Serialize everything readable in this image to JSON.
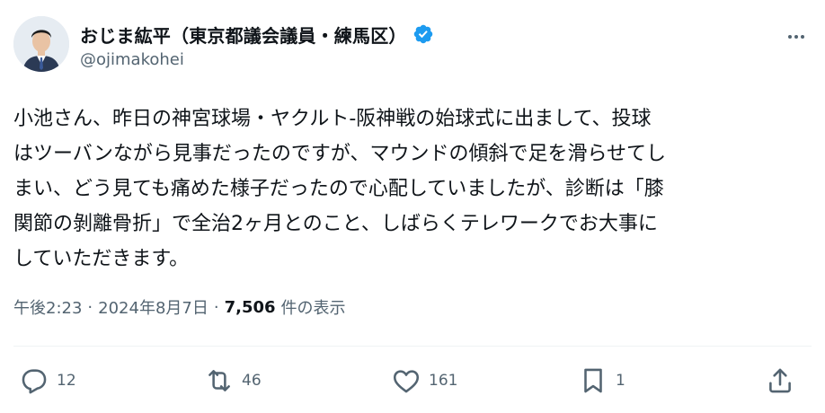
{
  "author": {
    "display_name": "おじま紘平（東京都議会議員・練馬区）",
    "handle": "@ojimakohei",
    "verified": true,
    "avatar_icon": "avatar-photo",
    "verified_color": "#1d9bf0"
  },
  "more_icon": "more-horizontal-icon",
  "tweet": {
    "lines": [
      "小池さん、昨日の神宮球場・ヤクルト-阪神戦の始球式に出まして、投球",
      "はツーバンながら見事だったのですが、マウンドの傾斜で足を滑らせてし",
      "まい、どう見ても痛めた様子だったので心配していましたが、診断は「膝",
      "関節の剝離骨折」で全治2ヶ月とのこと、しばらくテレワークでお大事に",
      "していただきます。"
    ]
  },
  "meta": {
    "time": "午後2:23",
    "separator": "·",
    "date": "2024年8月7日",
    "views_count": "7,506",
    "views_label": "件の表示"
  },
  "actions": {
    "reply": {
      "icon": "reply-icon",
      "count": "12"
    },
    "retweet": {
      "icon": "retweet-icon",
      "count": "46"
    },
    "like": {
      "icon": "like-icon",
      "count": "161"
    },
    "bookmark": {
      "icon": "bookmark-icon",
      "count": "1"
    },
    "share": {
      "icon": "share-icon"
    }
  },
  "colors": {
    "text_primary": "#0f1419",
    "text_secondary": "#536471",
    "divider": "#eff3f4"
  }
}
